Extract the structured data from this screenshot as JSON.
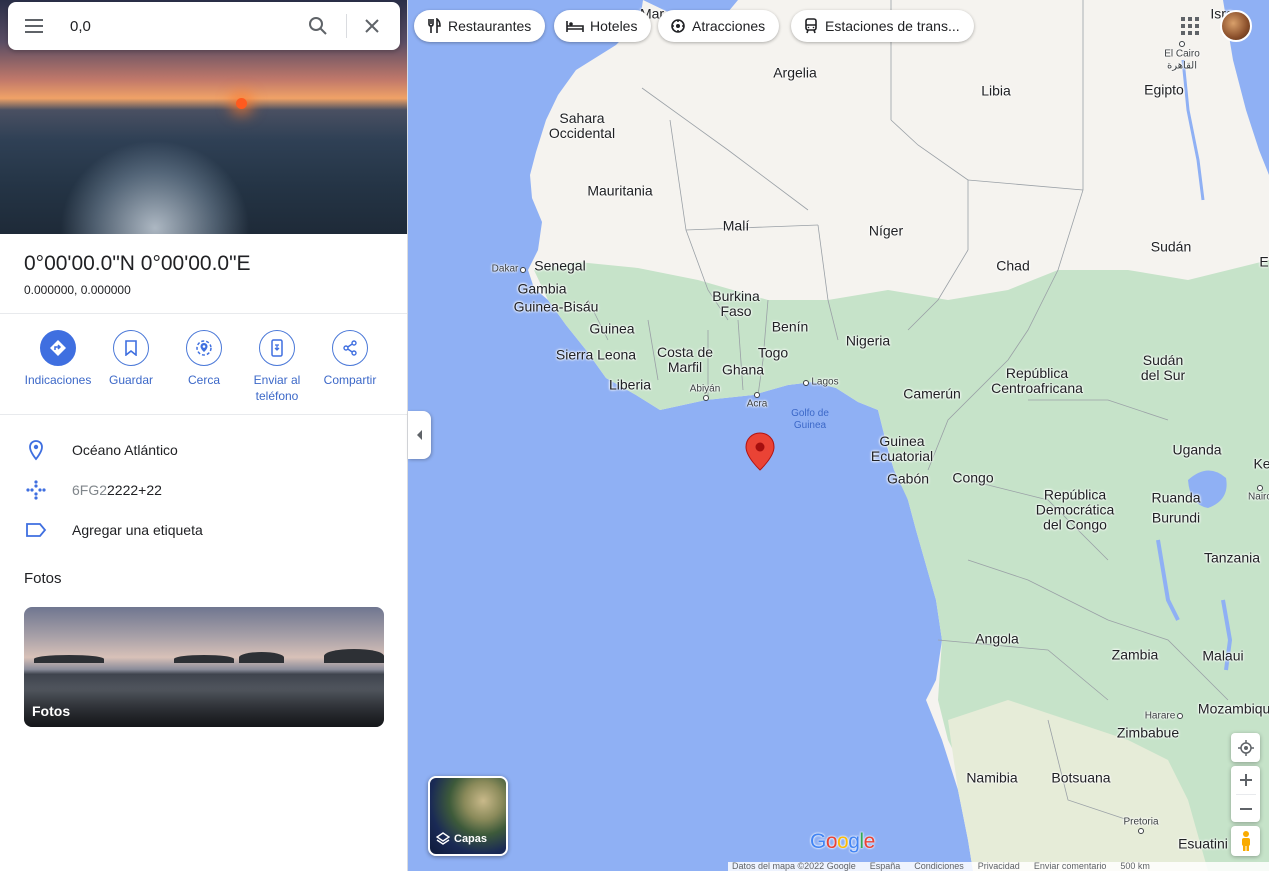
{
  "search": {
    "query": "0,0"
  },
  "chips": [
    {
      "label": "Restaurantes",
      "icon": "fork-knife-icon"
    },
    {
      "label": "Hoteles",
      "icon": "bed-icon"
    },
    {
      "label": "Atracciones",
      "icon": "attraction-icon"
    },
    {
      "label": "Estaciones de trans...",
      "icon": "transit-icon"
    }
  ],
  "place": {
    "title": "0°00'00.0\"N 0°00'00.0\"E",
    "coordinates": "0.000000, 0.000000"
  },
  "actions": [
    {
      "label": "Indicaciones",
      "icon": "directions-icon"
    },
    {
      "label": "Guardar",
      "icon": "bookmark-icon"
    },
    {
      "label": "Cerca",
      "icon": "nearby-icon"
    },
    {
      "label": "Enviar al teléfono",
      "icon": "send-to-phone-icon"
    },
    {
      "label": "Compartir",
      "icon": "share-icon"
    }
  ],
  "info": {
    "location": "Océano Atlántico",
    "plus_code_prefix": "6FG2",
    "plus_code_rest": "2222+22",
    "label_action": "Agregar una etiqueta"
  },
  "photos": {
    "heading": "Fotos",
    "card_label": "Fotos"
  },
  "map": {
    "labels": {
      "argelia": "Argelia",
      "libia": "Libia",
      "egipto": "Egipto",
      "sahara": "Sahara\nOccidental",
      "mauritania": "Mauritania",
      "mali": "Malí",
      "niger": "Níger",
      "chad": "Chad",
      "sudan": "Sudán",
      "senegal": "Senegal",
      "gambia": "Gambia",
      "guinea_bisau": "Guinea-Bisáu",
      "guinea": "Guinea",
      "sierra_leona": "Sierra Leona",
      "liberia": "Liberia",
      "costa_marfil": "Costa de\nMarfil",
      "ghana": "Ghana",
      "burkina": "Burkina\nFaso",
      "togo": "Togo",
      "benin": "Benín",
      "nigeria": "Nigeria",
      "camerun": "Camerún",
      "rep_centro": "República\nCentroafricana",
      "sudan_sur": "Sudán\ndel Sur",
      "guinea_ec": "Guinea\nEcuatorial",
      "gabon": "Gabón",
      "congo": "Congo",
      "rdc": "República\nDemocrática\ndel Congo",
      "uganda": "Uganda",
      "ruanda": "Ruanda",
      "burundi": "Burundi",
      "tanzania": "Tanzania",
      "angola": "Angola",
      "zambia": "Zambia",
      "malaui": "Malaui",
      "mozambique": "Mozambique",
      "zimbabue": "Zimbabue",
      "namibia": "Namibia",
      "botsuana": "Botsuana",
      "esuatini": "Esuatini",
      "kenia_partial": "Ke",
      "israel_partial": "Isra",
      "mar_partial": "Mar",
      "e_partial": "E",
      "dakar": "Dakar",
      "abiyan": "Abiyán",
      "acra": "Acra",
      "lagos": "Lagos",
      "el_cairo": "El Cairo",
      "el_cairo_ar": "القاهرة",
      "harare": "Harare",
      "pretoria": "Pretoria",
      "nairobi_partial": "Nairo",
      "golfo": "Golfo de\nGuinea"
    },
    "brand": "Google",
    "layers_label": "Capas",
    "footer": [
      "Datos del mapa ©2022 Google",
      "España",
      "Condiciones",
      "Privacidad",
      "Enviar comentario",
      "500 km"
    ],
    "colors": {
      "water": "#8fb0f4",
      "land": "#f5f3ef",
      "vegetation": "#c6e3c9",
      "marker": "#ea4335",
      "accent": "#3f6fe0"
    }
  }
}
